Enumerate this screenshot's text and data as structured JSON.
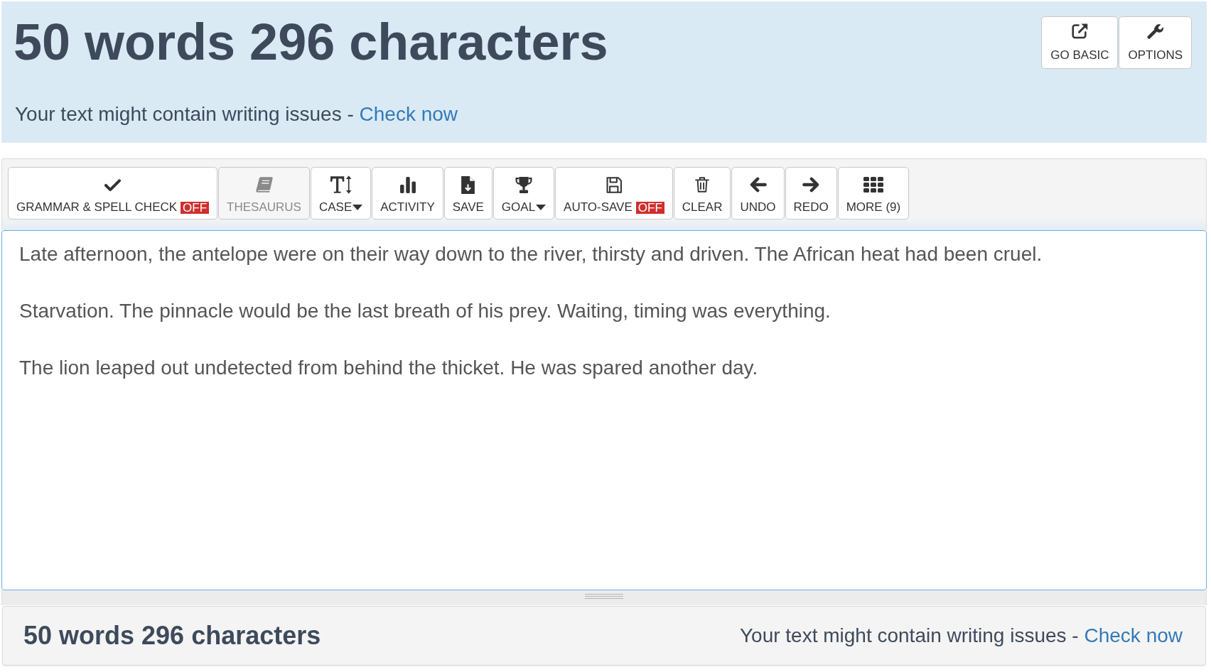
{
  "header": {
    "title": "50 words 296 characters",
    "notice": {
      "text": "Your text might contain writing issues -",
      "link": "Check now"
    },
    "buttons": [
      {
        "label": "GO BASIC"
      },
      {
        "label": "OPTIONS"
      }
    ]
  },
  "toolbar": {
    "buttons": [
      {
        "label": "GRAMMAR & SPELL CHECK",
        "badge": "OFF",
        "disabled": false,
        "dropdown": false
      },
      {
        "label": "THESAURUS",
        "disabled": true,
        "dropdown": false
      },
      {
        "label": "CASE",
        "disabled": false,
        "dropdown": true
      },
      {
        "label": "ACTIVITY",
        "disabled": false,
        "dropdown": false
      },
      {
        "label": "SAVE",
        "disabled": false,
        "dropdown": false
      },
      {
        "label": "GOAL",
        "disabled": false,
        "dropdown": true
      },
      {
        "label": "AUTO-SAVE",
        "badge": "OFF",
        "disabled": false,
        "dropdown": false
      },
      {
        "label": "CLEAR",
        "disabled": false,
        "dropdown": false
      },
      {
        "label": "UNDO",
        "disabled": false,
        "dropdown": false
      },
      {
        "label": "REDO",
        "disabled": false,
        "dropdown": false
      },
      {
        "label": "MORE (9)",
        "disabled": false,
        "dropdown": false
      }
    ]
  },
  "editor": {
    "paragraphs": [
      "Late afternoon, the antelope were on their way down to the river, thirsty and driven. The African heat had been cruel.",
      "Starvation. The pinnacle would be the last breath of his prey. Waiting, timing was everything.",
      "The lion leaped out undetected from behind the thicket. He was spared another day."
    ]
  },
  "footer": {
    "title": "50 words 296 characters",
    "notice": {
      "text": "Your text might contain writing issues -",
      "link": "Check now"
    }
  }
}
